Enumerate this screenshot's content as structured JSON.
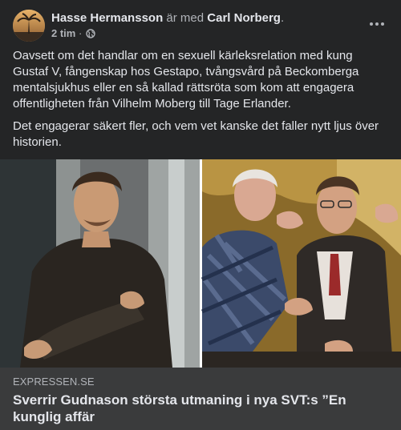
{
  "post": {
    "author": "Hasse Hermansson",
    "with_text": "är med",
    "tagged": "Carl Norberg",
    "tagged_suffix": ".",
    "time": "2 tim",
    "separator": "·",
    "privacy_icon": "globe-icon",
    "more_icon": "more-options-icon",
    "paragraphs": [
      "Oavsett om det handlar om en sexuell kärleksrelation med kung Gustaf V, fångenskap hos Gestapo, tvångsvård på Beckomberga mentalsjukhus eller en så kallad rättsröta som kom att engagera offentligheten från Vilhelm Moberg till Tage Erlander.",
      "Det engagerar säkert fler, och vem vet kanske det faller nytt ljus över historien."
    ]
  },
  "link_preview": {
    "domain": "EXPRESSEN.SE",
    "headline": "Sverrir Gudnason största utmaning i nya SVT:s ”En kunglig affär"
  },
  "colors": {
    "background": "#242526",
    "link_box": "#3a3b3c",
    "primary_text": "#e4e6eb",
    "secondary_text": "#b0b3b8"
  }
}
